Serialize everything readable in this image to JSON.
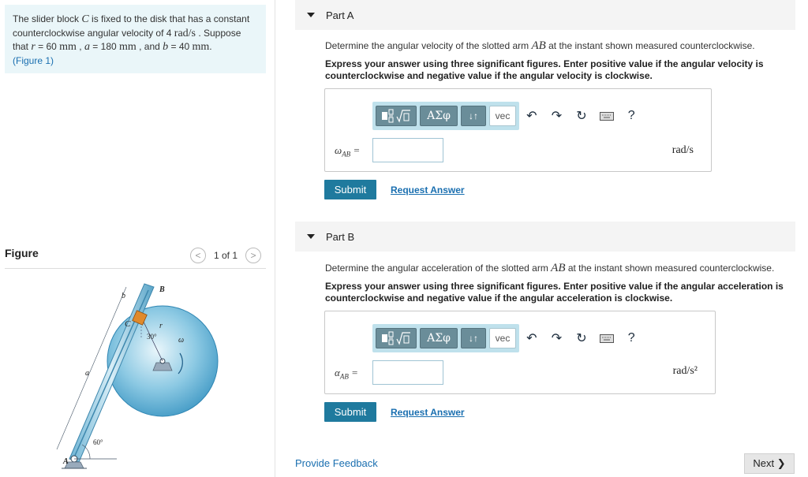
{
  "problem": {
    "t1": "The slider block ",
    "v_C": "C",
    "t2": " is fixed to the disk that has a constant counterclockwise angular velocity of 4 ",
    "u_rads": "rad/s",
    "t3": " . Suppose that ",
    "v_r": "r",
    "t4": " = 60  ",
    "u_mm1": "mm",
    "t5": " , ",
    "v_a": "a",
    "t6": " = 180  ",
    "u_mm2": "mm",
    "t7": " , and ",
    "v_b": "b",
    "t8": " = 40 ",
    "u_mm3": "mm",
    "t9": ".",
    "figure_link": "(Figure 1)"
  },
  "figure": {
    "heading": "Figure",
    "counter": "1 of 1",
    "prev_icon": "<",
    "next_icon": ">",
    "labels": {
      "B": "B",
      "b": "b",
      "C": "C",
      "r": "r",
      "omega": "ω",
      "a": "a",
      "angle30": "30°",
      "angle60": "60°",
      "A": "A"
    }
  },
  "partA": {
    "title": "Part A",
    "q1": "Determine the angular velocity of the slotted arm ",
    "q_var": "AB",
    "q2": " at the instant shown measured counterclockwise.",
    "instr": "Express your answer using three significant figures. Enter positive value if the angular velocity is counterclockwise and negative value if the angular velocity is clockwise.",
    "var_symbol": "ω",
    "var_sub": "AB",
    "equals": " =",
    "unit": "rad/s",
    "submit": "Submit",
    "request": "Request Answer"
  },
  "partB": {
    "title": "Part B",
    "q1": "Determine the angular acceleration of the slotted arm ",
    "q_var": "AB",
    "q2": " at the instant shown measured counterclockwise.",
    "instr": "Express your answer using three significant figures. Enter positive value if the angular acceleration is counterclockwise and negative value if the angular acceleration is clockwise.",
    "var_symbol": "α",
    "var_sub": "AB",
    "equals": " =",
    "unit": "rad/s²",
    "submit": "Submit",
    "request": "Request Answer"
  },
  "toolbar": {
    "greek": "ΑΣφ",
    "sort": "↓↑",
    "vec": "vec",
    "undo": "↶",
    "redo": "↷",
    "reset": "↻",
    "help": "?"
  },
  "footer": {
    "feedback": "Provide Feedback",
    "next": "Next ❯"
  }
}
